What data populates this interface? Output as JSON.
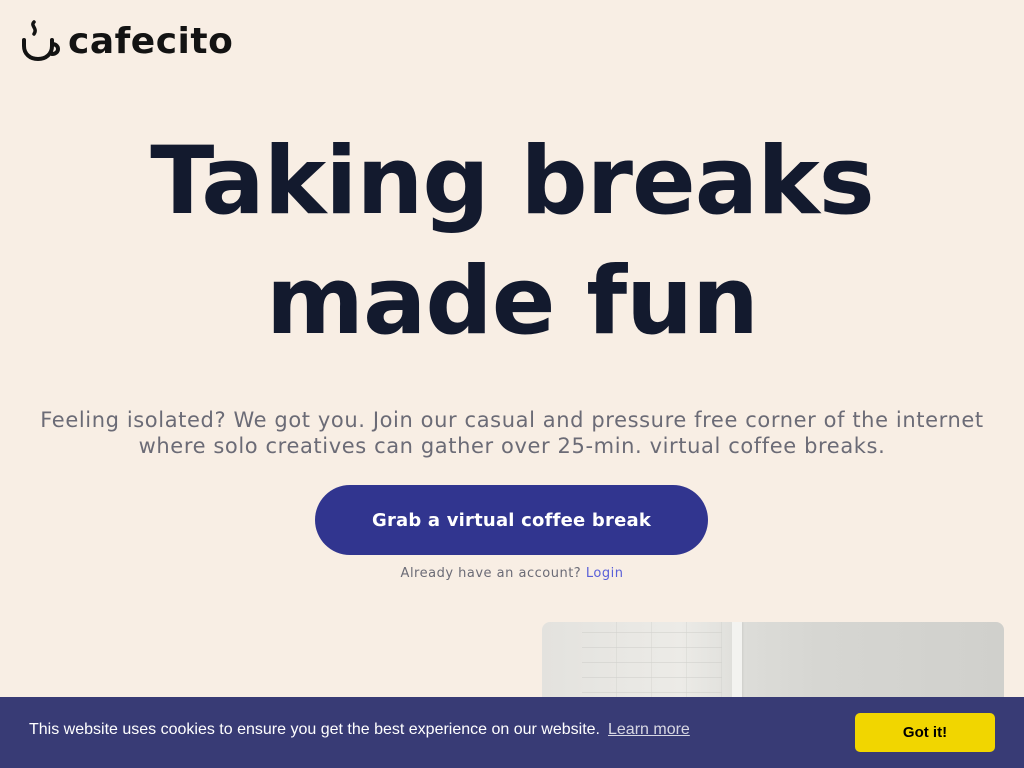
{
  "brand": {
    "name": "cafecito",
    "logo_icon": "coffee-cup-icon"
  },
  "hero": {
    "title_line1": "Taking breaks",
    "title_line2": "made fun",
    "subtitle_line1": "Feeling isolated? We got you. Join our casual and pressure free corner of the internet",
    "subtitle_line2": "where solo creatives can gather over 25-min. virtual coffee breaks.",
    "cta_label": "Grab a virtual coffee break",
    "login_prompt": "Already have an account?",
    "login_link": "Login"
  },
  "cookie_banner": {
    "message": "This website uses cookies to ensure you get the best experience on our website.",
    "learn_more": "Learn more",
    "accept_label": "Got it!"
  },
  "colors": {
    "background": "#f8eee4",
    "headline": "#131a2e",
    "cta_bg": "#31358f",
    "link": "#5a60d8",
    "cookie_bg": "#383b75",
    "cookie_btn": "#f1d600"
  }
}
